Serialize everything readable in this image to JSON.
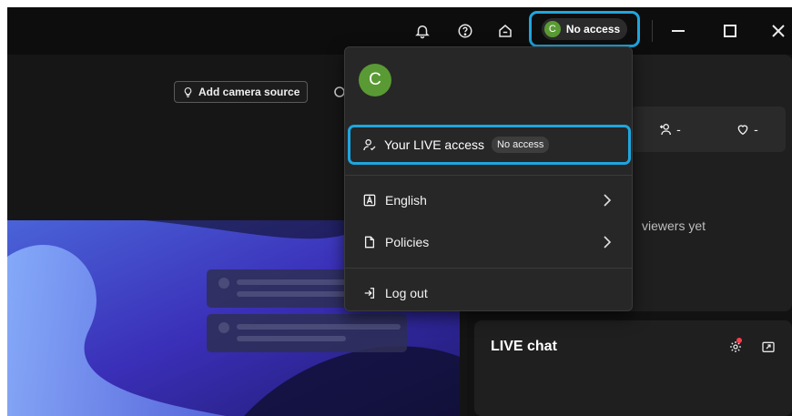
{
  "topbar": {
    "account_label": "No access",
    "avatar_initial": "C",
    "icons": [
      "bell-icon",
      "help-icon",
      "home-icon"
    ]
  },
  "stage": {
    "add_camera_label": "Add camera source"
  },
  "menu": {
    "avatar_initial": "C",
    "live_access_label": "Your LIVE access",
    "live_access_status": "No access",
    "items": [
      {
        "label": "English",
        "icon": "language-icon",
        "has_submenu": true
      },
      {
        "label": "Policies",
        "icon": "document-icon",
        "has_submenu": true
      },
      {
        "label": "Log out",
        "icon": "logout-icon",
        "has_submenu": false
      }
    ]
  },
  "viewers": {
    "new_followers": "-",
    "likes": "-",
    "empty_text": "viewers yet"
  },
  "chat": {
    "title": "LIVE chat"
  },
  "colors": {
    "accent": "#1fa6e0",
    "avatar": "#5a9a34",
    "notification_dot": "#ff3b4f"
  }
}
